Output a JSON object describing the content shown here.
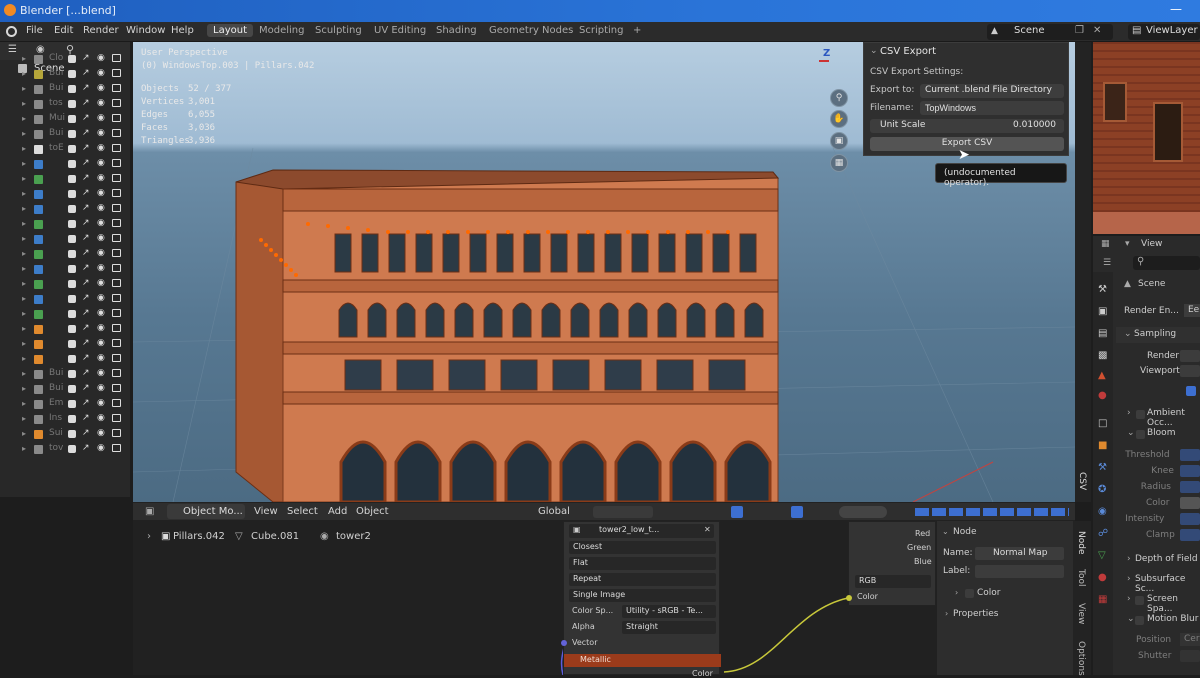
{
  "window": {
    "title": "Blender [...blend]"
  },
  "menubar": {
    "menus": [
      "File",
      "Edit",
      "Render",
      "Window",
      "Help"
    ],
    "workspaces": [
      "Layout",
      "Modeling",
      "Sculpting",
      "UV Editing",
      "Shading",
      "Geometry Nodes",
      "Scripting",
      "+"
    ],
    "active_workspace": "Layout",
    "scene_label": "Scene",
    "viewlayer_label": "ViewLayer"
  },
  "outliner": {
    "scene_label": "Scene",
    "rows": [
      {
        "name": "Clo",
        "color": "#8a8a8a"
      },
      {
        "name": "Bui",
        "color": "#b5a63a"
      },
      {
        "name": "Bui",
        "color": "#8a8a8a"
      },
      {
        "name": "tos",
        "color": "#8a8a8a"
      },
      {
        "name": "Mui",
        "color": "#8a8a8a"
      },
      {
        "name": "Bui",
        "color": "#8a8a8a"
      },
      {
        "name": "toE",
        "color": "#dddddd"
      },
      {
        "name": "",
        "color": "#3d7dc9"
      },
      {
        "name": "",
        "color": "#4aa050"
      },
      {
        "name": "",
        "color": "#3d7dc9"
      },
      {
        "name": "",
        "color": "#3d7dc9"
      },
      {
        "name": "",
        "color": "#4aa050"
      },
      {
        "name": "",
        "color": "#3d7dc9"
      },
      {
        "name": "",
        "color": "#4aa050"
      },
      {
        "name": "",
        "color": "#3d7dc9"
      },
      {
        "name": "",
        "color": "#4aa050"
      },
      {
        "name": "",
        "color": "#3d7dc9"
      },
      {
        "name": "",
        "color": "#4aa050"
      },
      {
        "name": "",
        "color": "#e08a2e"
      },
      {
        "name": "",
        "color": "#e08a2e"
      },
      {
        "name": "",
        "color": "#e08a2e"
      },
      {
        "name": "Bui",
        "color": "#8a8a8a"
      },
      {
        "name": "Bui",
        "color": "#8a8a8a"
      },
      {
        "name": "Em",
        "color": "#8a8a8a"
      },
      {
        "name": "Ins",
        "color": "#8a8a8a"
      },
      {
        "name": "Sui",
        "color": "#e08a2e"
      },
      {
        "name": "tov",
        "color": "#8a8a8a"
      }
    ]
  },
  "viewport": {
    "perspective": "User Perspective",
    "context": "(0) WindowsTop.003 | Pillars.042",
    "stats": [
      {
        "label": "Objects",
        "value": "52 / 377"
      },
      {
        "label": "Vertices",
        "value": "3,001"
      },
      {
        "label": "Edges",
        "value": "6,055"
      },
      {
        "label": "Faces",
        "value": "3,036"
      },
      {
        "label": "Triangles",
        "value": "3,936"
      }
    ],
    "gizmo_z": "Z",
    "csv_tab": "CSV"
  },
  "csv_panel": {
    "title": "CSV Export",
    "settings_label": "CSV Export Settings:",
    "export_to_label": "Export to:",
    "export_to_value": "Current .blend File Directory",
    "filename_label": "Filename:",
    "filename_value": "TopWindows",
    "unit_scale_label": "Unit Scale",
    "unit_scale_value": "0.010000",
    "export_button": "Export CSV",
    "tooltip": "(undocumented operator)."
  },
  "viewport_header": {
    "mode": "Object Mo...",
    "items": [
      "View",
      "Select",
      "Add",
      "Object"
    ],
    "orientation": "Global"
  },
  "node_editor": {
    "breadcrumb": [
      "Pillars.042",
      "Cube.081",
      "tower2"
    ],
    "image_node": {
      "title": "tower2_low_t...",
      "rows": [
        "Closest",
        "Flat",
        "Repeat",
        "Single Image"
      ],
      "colorspace_label": "Color Sp...",
      "colorspace_value": "Utility - sRGB - Te...",
      "alpha_label": "Alpha",
      "alpha_value": "Straight",
      "vector_label": "Vector",
      "metallic_label": "Metallic",
      "color_out": "Color"
    },
    "rgb_node": {
      "outputs": [
        "Red",
        "Green",
        "Blue"
      ],
      "mode": "RGB",
      "color_label": "Color"
    },
    "sidebar": {
      "section": "Node",
      "name_label": "Name:",
      "name_value": "Normal Map",
      "label_label": "Label:",
      "color_section": "Color",
      "properties_section": "Properties",
      "tabs": [
        "Node",
        "Tool",
        "View",
        "Options"
      ]
    }
  },
  "properties": {
    "header_view": "View",
    "scene_label": "Scene",
    "render_engine_label": "Render En...",
    "render_engine_value": "Ee",
    "sampling_label": "Sampling",
    "render_label": "Render",
    "viewport_label": "Viewport",
    "ambient_label": "Ambient Occ...",
    "bloom_label": "Bloom",
    "bloom_fields": [
      "Threshold",
      "Knee",
      "Radius",
      "Color",
      "Intensity",
      "Clamp"
    ],
    "dof_label": "Depth of Field",
    "sss_label": "Subsurface Sc...",
    "ssr_label": "Screen Spa...",
    "motion_blur_label": "Motion Blur",
    "position_label": "Position",
    "position_value": "Cer",
    "shutter_label": "Shutter"
  }
}
